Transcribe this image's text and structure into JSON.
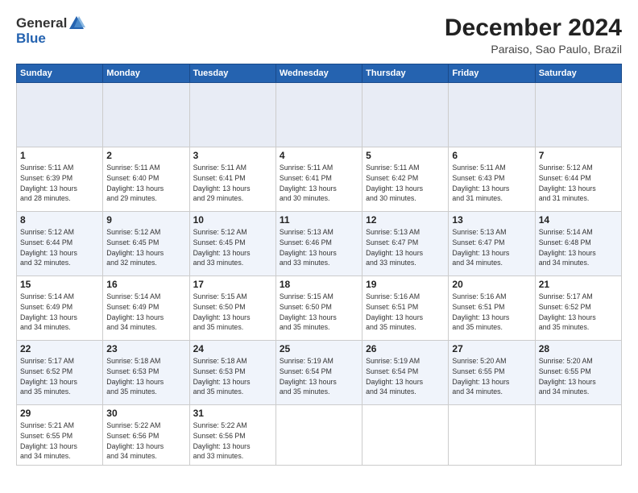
{
  "header": {
    "logo_general": "General",
    "logo_blue": "Blue",
    "main_title": "December 2024",
    "subtitle": "Paraiso, Sao Paulo, Brazil"
  },
  "calendar": {
    "columns": [
      "Sunday",
      "Monday",
      "Tuesday",
      "Wednesday",
      "Thursday",
      "Friday",
      "Saturday"
    ],
    "weeks": [
      [
        {
          "day": "",
          "info": ""
        },
        {
          "day": "",
          "info": ""
        },
        {
          "day": "",
          "info": ""
        },
        {
          "day": "",
          "info": ""
        },
        {
          "day": "",
          "info": ""
        },
        {
          "day": "",
          "info": ""
        },
        {
          "day": "",
          "info": ""
        }
      ],
      [
        {
          "day": "1",
          "info": "Sunrise: 5:11 AM\nSunset: 6:39 PM\nDaylight: 13 hours\nand 28 minutes."
        },
        {
          "day": "2",
          "info": "Sunrise: 5:11 AM\nSunset: 6:40 PM\nDaylight: 13 hours\nand 29 minutes."
        },
        {
          "day": "3",
          "info": "Sunrise: 5:11 AM\nSunset: 6:41 PM\nDaylight: 13 hours\nand 29 minutes."
        },
        {
          "day": "4",
          "info": "Sunrise: 5:11 AM\nSunset: 6:41 PM\nDaylight: 13 hours\nand 30 minutes."
        },
        {
          "day": "5",
          "info": "Sunrise: 5:11 AM\nSunset: 6:42 PM\nDaylight: 13 hours\nand 30 minutes."
        },
        {
          "day": "6",
          "info": "Sunrise: 5:11 AM\nSunset: 6:43 PM\nDaylight: 13 hours\nand 31 minutes."
        },
        {
          "day": "7",
          "info": "Sunrise: 5:12 AM\nSunset: 6:44 PM\nDaylight: 13 hours\nand 31 minutes."
        }
      ],
      [
        {
          "day": "8",
          "info": "Sunrise: 5:12 AM\nSunset: 6:44 PM\nDaylight: 13 hours\nand 32 minutes."
        },
        {
          "day": "9",
          "info": "Sunrise: 5:12 AM\nSunset: 6:45 PM\nDaylight: 13 hours\nand 32 minutes."
        },
        {
          "day": "10",
          "info": "Sunrise: 5:12 AM\nSunset: 6:45 PM\nDaylight: 13 hours\nand 33 minutes."
        },
        {
          "day": "11",
          "info": "Sunrise: 5:13 AM\nSunset: 6:46 PM\nDaylight: 13 hours\nand 33 minutes."
        },
        {
          "day": "12",
          "info": "Sunrise: 5:13 AM\nSunset: 6:47 PM\nDaylight: 13 hours\nand 33 minutes."
        },
        {
          "day": "13",
          "info": "Sunrise: 5:13 AM\nSunset: 6:47 PM\nDaylight: 13 hours\nand 34 minutes."
        },
        {
          "day": "14",
          "info": "Sunrise: 5:14 AM\nSunset: 6:48 PM\nDaylight: 13 hours\nand 34 minutes."
        }
      ],
      [
        {
          "day": "15",
          "info": "Sunrise: 5:14 AM\nSunset: 6:49 PM\nDaylight: 13 hours\nand 34 minutes."
        },
        {
          "day": "16",
          "info": "Sunrise: 5:14 AM\nSunset: 6:49 PM\nDaylight: 13 hours\nand 34 minutes."
        },
        {
          "day": "17",
          "info": "Sunrise: 5:15 AM\nSunset: 6:50 PM\nDaylight: 13 hours\nand 35 minutes."
        },
        {
          "day": "18",
          "info": "Sunrise: 5:15 AM\nSunset: 6:50 PM\nDaylight: 13 hours\nand 35 minutes."
        },
        {
          "day": "19",
          "info": "Sunrise: 5:16 AM\nSunset: 6:51 PM\nDaylight: 13 hours\nand 35 minutes."
        },
        {
          "day": "20",
          "info": "Sunrise: 5:16 AM\nSunset: 6:51 PM\nDaylight: 13 hours\nand 35 minutes."
        },
        {
          "day": "21",
          "info": "Sunrise: 5:17 AM\nSunset: 6:52 PM\nDaylight: 13 hours\nand 35 minutes."
        }
      ],
      [
        {
          "day": "22",
          "info": "Sunrise: 5:17 AM\nSunset: 6:52 PM\nDaylight: 13 hours\nand 35 minutes."
        },
        {
          "day": "23",
          "info": "Sunrise: 5:18 AM\nSunset: 6:53 PM\nDaylight: 13 hours\nand 35 minutes."
        },
        {
          "day": "24",
          "info": "Sunrise: 5:18 AM\nSunset: 6:53 PM\nDaylight: 13 hours\nand 35 minutes."
        },
        {
          "day": "25",
          "info": "Sunrise: 5:19 AM\nSunset: 6:54 PM\nDaylight: 13 hours\nand 35 minutes."
        },
        {
          "day": "26",
          "info": "Sunrise: 5:19 AM\nSunset: 6:54 PM\nDaylight: 13 hours\nand 34 minutes."
        },
        {
          "day": "27",
          "info": "Sunrise: 5:20 AM\nSunset: 6:55 PM\nDaylight: 13 hours\nand 34 minutes."
        },
        {
          "day": "28",
          "info": "Sunrise: 5:20 AM\nSunset: 6:55 PM\nDaylight: 13 hours\nand 34 minutes."
        }
      ],
      [
        {
          "day": "29",
          "info": "Sunrise: 5:21 AM\nSunset: 6:55 PM\nDaylight: 13 hours\nand 34 minutes."
        },
        {
          "day": "30",
          "info": "Sunrise: 5:22 AM\nSunset: 6:56 PM\nDaylight: 13 hours\nand 34 minutes."
        },
        {
          "day": "31",
          "info": "Sunrise: 5:22 AM\nSunset: 6:56 PM\nDaylight: 13 hours\nand 33 minutes."
        },
        {
          "day": "",
          "info": ""
        },
        {
          "day": "",
          "info": ""
        },
        {
          "day": "",
          "info": ""
        },
        {
          "day": "",
          "info": ""
        }
      ]
    ]
  }
}
